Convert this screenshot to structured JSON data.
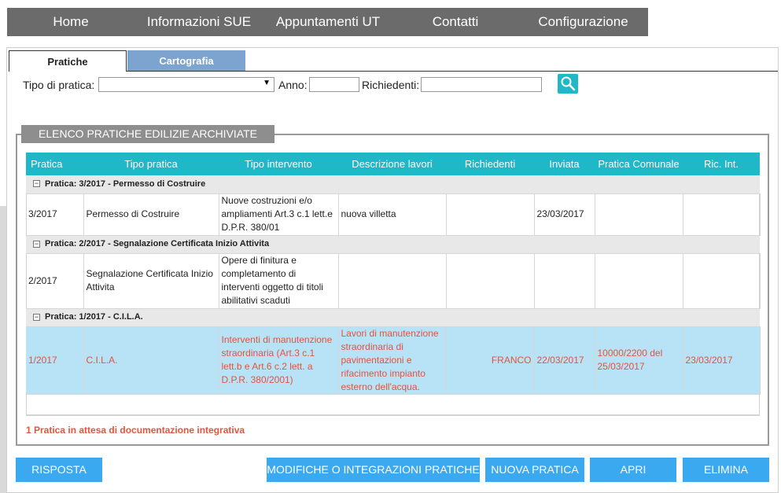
{
  "nav": {
    "items": [
      "Home",
      "Informazioni SUE",
      "Appuntamenti UT",
      "Contatti",
      "Configurazione"
    ]
  },
  "tabs": {
    "pratiche": "Pratiche",
    "cartografia": "Cartografia"
  },
  "filters": {
    "tipo_label": "Tipo di pratica:",
    "anno_label": "Anno:",
    "richiedenti_label": "Richiedenti:"
  },
  "legend": "ELENCO PRATICHE EDILIZIE ARCHIVIATE",
  "table": {
    "columns": [
      "Pratica",
      "Tipo pratica",
      "Tipo intervento",
      "Descrizione lavori",
      "Richiedenti",
      "Inviata",
      "Pratica Comunale",
      "Ric. Int."
    ],
    "groups": [
      {
        "header": "Pratica: 3/2017 - Permesso di Costruire",
        "row": [
          "3/2017",
          "Permesso di Costruire",
          "Nuove costruzioni e/o ampliamenti Art.3 c.1 lett.e D.P.R. 380/01",
          "nuova villetta",
          "",
          "23/03/2017",
          "",
          ""
        ]
      },
      {
        "header": "Pratica: 2/2017 - Segnalazione Certificata Inizio Attivita",
        "row": [
          "2/2017",
          "Segnalazione Certificata Inizio Attivita",
          "Opere di finitura e completamento di interventi oggetto di titoli abilitativi scaduti",
          "",
          "",
          "",
          "",
          ""
        ]
      },
      {
        "header": "Pratica: 1/2017 - C.I.L.A.",
        "row": [
          "1/2017",
          "C.I.L.A.",
          "Interventi di manutenzione straordinaria (Art.3 c.1 lett.b e Art.6 c.2 lett. a D.P.R. 380/2001)",
          "Lavori di manutenzione straordinaria di pavimentazioni e rifacimento impianto esterno dell'acqua.",
          "FRANCO",
          "22/03/2017",
          "10000/2200 del 25/03/2017",
          "23/03/2017"
        ]
      }
    ]
  },
  "note": "1 Pratica in attesa di documentazione integrativa",
  "buttons": {
    "risposta": "RISPOSTA",
    "modifiche": "MODIFICHE O INTEGRAZIONI PRATICHE",
    "nuova": "NUOVA PRATICA",
    "apri": "APRI",
    "elimina": "ELIMINA"
  },
  "colors": {
    "accent": "#1fb8c8",
    "button": "#3aa9f0",
    "highlight_row": "#b8e2f6",
    "alert_text": "#e5533d",
    "nav_bg": "#6b6b6b",
    "tab_carto": "#7da3cf"
  },
  "icons": {
    "search": "magnifier-icon",
    "toggle": "collapse-minus-icon"
  }
}
